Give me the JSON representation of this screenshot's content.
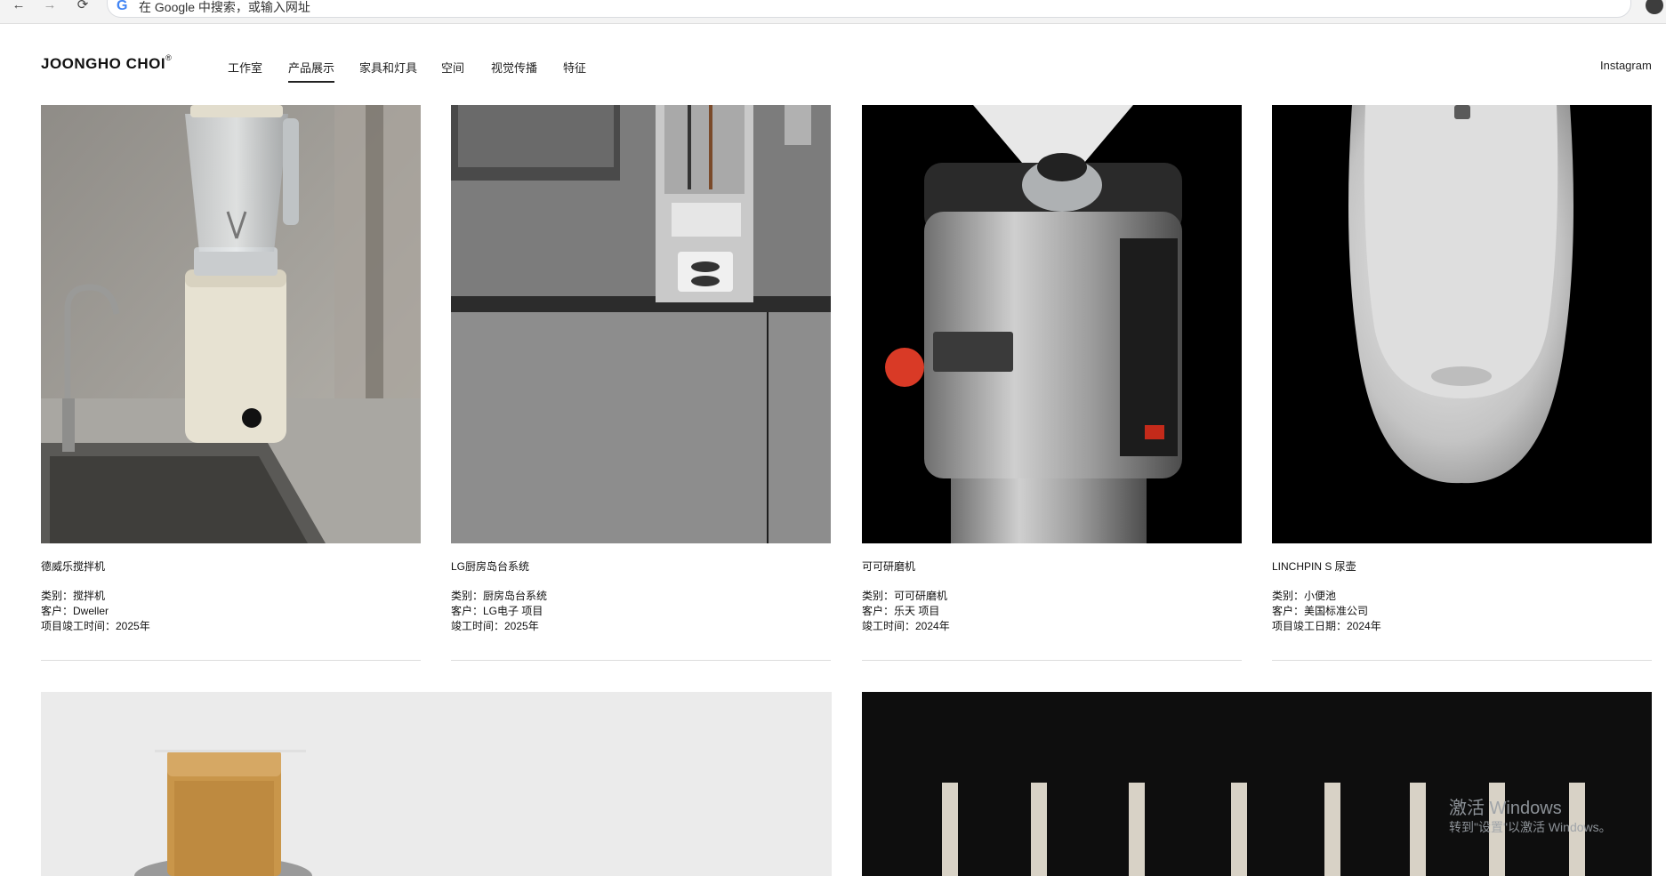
{
  "browser": {
    "address_placeholder": "在 Google 中搜索，或输入网址",
    "back_glyph": "←",
    "forward_glyph": "→",
    "reload_glyph": "⟳"
  },
  "site": {
    "logo": "JOONGHO CHOI",
    "logo_mark": "®",
    "nav": [
      "工作室",
      "产品展示",
      "家具和灯具",
      "空间",
      "视觉传播",
      "特征"
    ],
    "active_nav": "产品展示",
    "instagram": "Instagram"
  },
  "products": [
    {
      "title": "德威乐搅拌机",
      "category": "类别：搅拌机",
      "client": "客户：Dweller",
      "completion": "项目竣工时间：2025年"
    },
    {
      "title": "LG厨房岛台系统",
      "category": "类别：厨房岛台系统",
      "client": "客户：LG电子 项目",
      "completion": "竣工时间：2025年"
    },
    {
      "title": "可可研磨机",
      "category": "类别：可可研磨机",
      "client": "客户：乐天 项目",
      "completion": "竣工时间：2024年"
    },
    {
      "title": "LINCHPIN S 尿壶",
      "category": "类别：小便池",
      "client": "客户：美国标准公司",
      "completion": "项目竣工日期：2024年"
    }
  ],
  "watermark": {
    "line1": "激活 Windows",
    "line2": "转到\"设置\"以激活 Windows。"
  },
  "colors": {
    "text": "#111111",
    "divider": "#dddddd",
    "dark_bg": "#0e0e0e",
    "light_bg": "#ebebeb"
  }
}
